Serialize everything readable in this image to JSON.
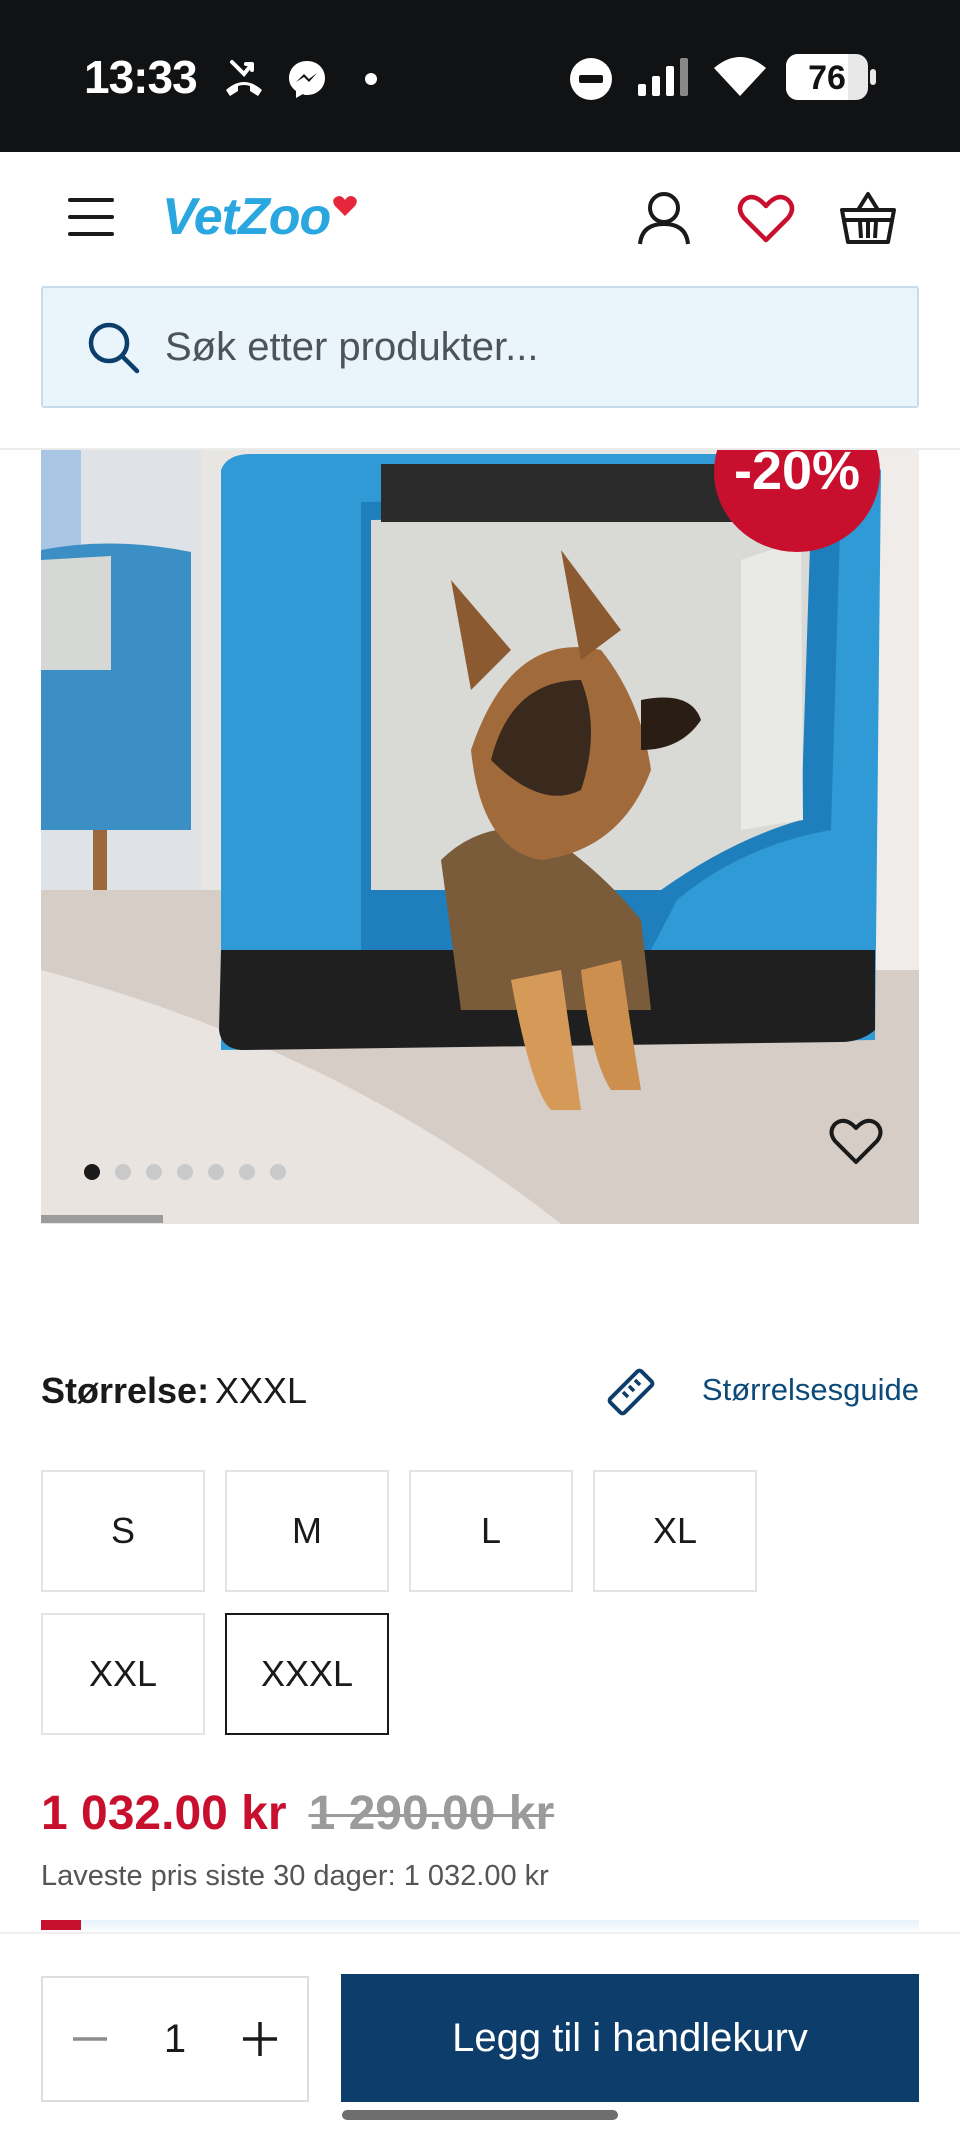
{
  "status_bar": {
    "time": "13:33",
    "battery": "76",
    "icons": [
      "missed-call-icon",
      "messenger-icon",
      "dot-icon",
      "do-not-disturb-icon",
      "signal-icon",
      "wifi-icon",
      "battery-icon"
    ]
  },
  "header": {
    "logo_text": "VetZoo",
    "icons": [
      "menu-icon",
      "account-icon",
      "heart-icon",
      "basket-icon"
    ]
  },
  "search": {
    "placeholder": "Søk etter produkter..."
  },
  "product": {
    "discount": "-20%",
    "image_count": 7,
    "active_image": 1
  },
  "size": {
    "label": "Størrelse:",
    "selected": "XXXL",
    "guide_label": "Størrelsesguide",
    "options": [
      "S",
      "M",
      "L",
      "XL",
      "XXL",
      "XXXL"
    ]
  },
  "price": {
    "current": "1 032.00 kr",
    "old": "1 290.00 kr",
    "lowest_label": "Laveste pris siste 30 dager: 1 032.00 kr"
  },
  "cart": {
    "quantity": "1",
    "add_label": "Legg til i handlekurv"
  },
  "colors": {
    "brand_blue": "#0c3d6b",
    "sale_red": "#c8102e",
    "logo_blue": "#2aa7df"
  }
}
